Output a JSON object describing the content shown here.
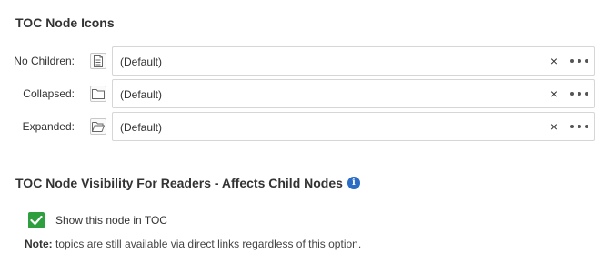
{
  "icons_section": {
    "title": "TOC Node Icons",
    "rows": [
      {
        "label": "No Children:",
        "icon": "document-icon",
        "value": "(Default)"
      },
      {
        "label": "Collapsed:",
        "icon": "folder-closed-icon",
        "value": "(Default)"
      },
      {
        "label": "Expanded:",
        "icon": "folder-open-icon",
        "value": "(Default)"
      }
    ],
    "clear_glyph": "×"
  },
  "visibility_section": {
    "title": "TOC Node Visibility For Readers - Affects Child Nodes",
    "info_glyph": "i",
    "checkbox": {
      "label": "Show this node in TOC",
      "checked": true,
      "color": "#2e9e3e"
    },
    "note_label": "Note:",
    "note_text": " topics are still available via direct links regardless of this option."
  }
}
